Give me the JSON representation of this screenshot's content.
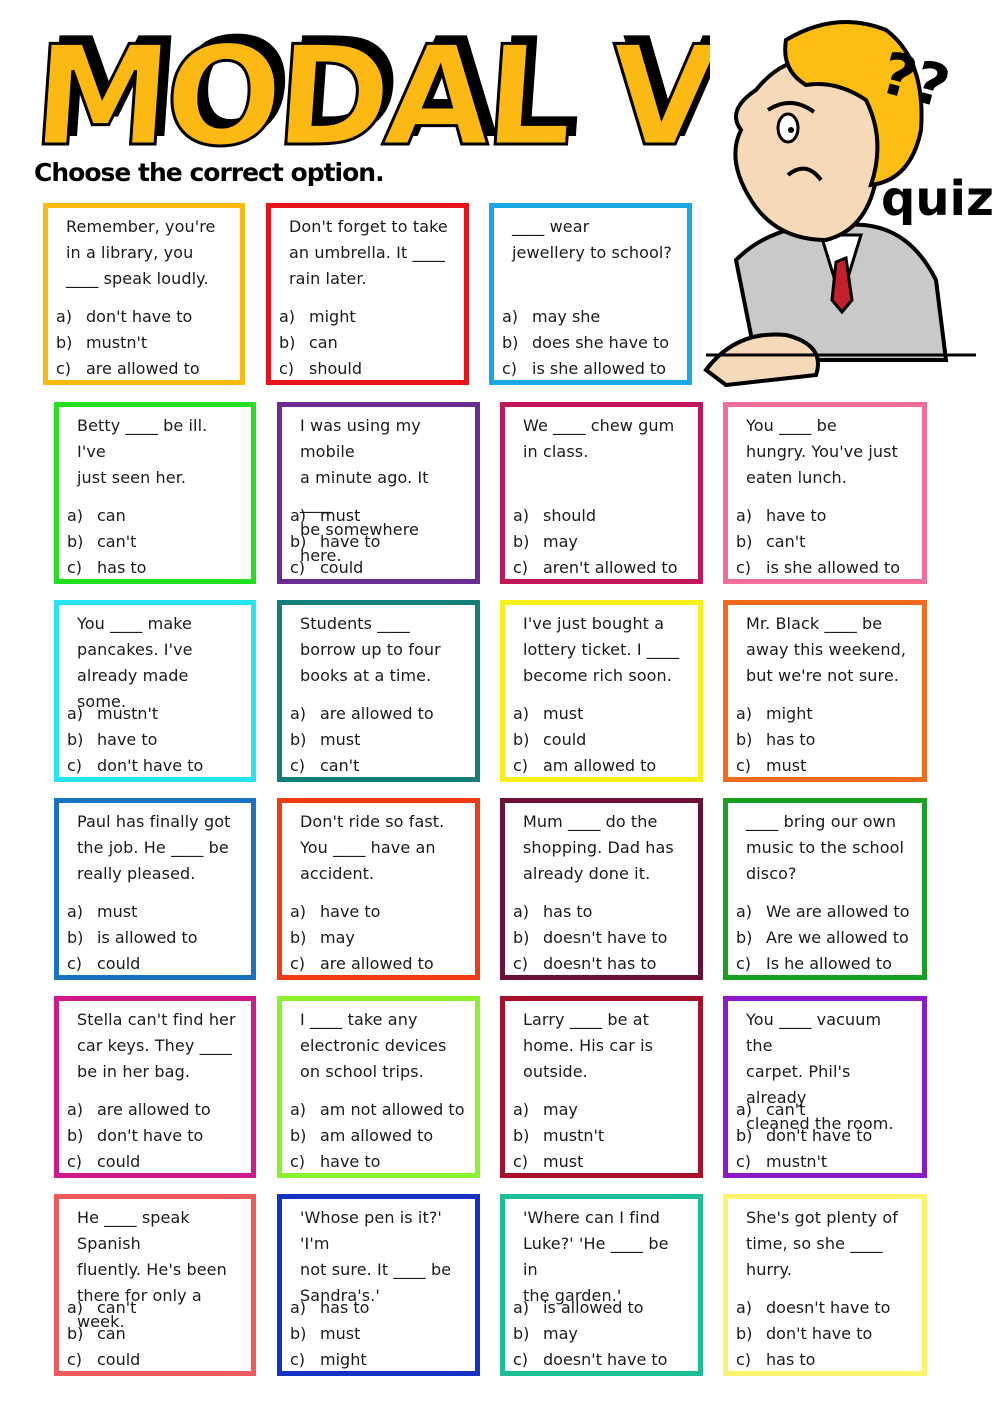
{
  "header": {
    "title": "MODAL VERBS",
    "instructions": "Choose the correct option.",
    "mascot_caption": "quiz",
    "mascot_marks": "??",
    "title_color": "#FDB913"
  },
  "option_letters": [
    "a)",
    "b)",
    "c)"
  ],
  "questions": [
    {
      "text": "Remember, you're\nin a library, you\n____ speak loudly.",
      "border": "#F9B90F",
      "options": [
        "don't have to",
        "mustn't",
        "are allowed to"
      ]
    },
    {
      "text": "Don't forget to take\nan umbrella. It ____\nrain later.",
      "border": "#E8141B",
      "options": [
        "might",
        "can",
        "should"
      ]
    },
    {
      "text": "____ wear\njewellery to school?",
      "border": "#1BA7E3",
      "options": [
        "may she",
        "does she have to",
        "is she allowed to"
      ]
    },
    {
      "text": "Betty ____ be ill. I've\njust seen her.",
      "border": "#22E01E",
      "options": [
        "can",
        "can't",
        "has to"
      ]
    },
    {
      "text": "I was using my mobile\na minute ago. It ____\nbe somewhere here.",
      "border": "#6A2C91",
      "options": [
        "must",
        "have to",
        "could"
      ]
    },
    {
      "text": "We ____ chew gum\nin class.",
      "border": "#C2185B",
      "options": [
        "should",
        "may",
        "aren't allowed to"
      ]
    },
    {
      "text": "You ____ be\nhungry. You've just\neaten lunch.",
      "border": "#F06C9B",
      "options": [
        "have to",
        "can't",
        "is she allowed to"
      ]
    },
    {
      "text": "You ____ make\npancakes. I've\nalready made some.",
      "border": "#24E5F0",
      "options": [
        "mustn't",
        "have to",
        "don't have to"
      ]
    },
    {
      "text": "Students ____\nborrow up to four\nbooks at a time.",
      "border": "#137D7A",
      "options": [
        "are allowed to",
        "must",
        "can't"
      ]
    },
    {
      "text": "I've just bought a\nlottery ticket. I ____\nbecome rich soon.",
      "border": "#F6F01A",
      "options": [
        "must",
        "could",
        "am allowed to"
      ]
    },
    {
      "text": "Mr. Black ____ be\naway this weekend,\nbut we're not sure.",
      "border": "#F26A1B",
      "options": [
        "might",
        "has to",
        "must"
      ]
    },
    {
      "text": "Paul has finally got\nthe job. He ____ be\nreally pleased.",
      "border": "#1A73C2",
      "options": [
        "must",
        "is allowed to",
        "could"
      ]
    },
    {
      "text": "Don't ride so fast.\nYou ____ have an\naccident.",
      "border": "#F23B12",
      "options": [
        "have to",
        "may",
        "are allowed to"
      ]
    },
    {
      "text": "Mum ____ do the\nshopping. Dad has\nalready done it.",
      "border": "#6B0F36",
      "options": [
        "has to",
        "doesn't have to",
        "doesn't has to"
      ]
    },
    {
      "text": "____ bring our own\nmusic to the school\ndisco?",
      "border": "#18A023",
      "options": [
        "We are allowed to",
        "Are we allowed to",
        "Is he allowed to"
      ]
    },
    {
      "text": "Stella can't find her\ncar keys. They ____\nbe in her bag.",
      "border": "#D0198B",
      "options": [
        "are allowed to",
        "don't have to",
        "could"
      ]
    },
    {
      "text": "I ____ take any\nelectronic devices\non school trips.",
      "border": "#8BF22B",
      "options": [
        "am not allowed to",
        "am allowed to",
        "have to"
      ]
    },
    {
      "text": "Larry ____ be at\nhome. His car is\noutside.",
      "border": "#A8102A",
      "options": [
        "may",
        "mustn't",
        "must"
      ]
    },
    {
      "text": "You ____ vacuum the\ncarpet. Phil's already\ncleaned the room.",
      "border": "#8E18C6",
      "options": [
        "can't",
        "don't have to",
        "mustn't"
      ]
    },
    {
      "text": "He ____ speak Spanish\nfluently. He's been\nthere for only a week.",
      "border": "#F05A5A",
      "options": [
        "can't",
        "can",
        "could"
      ]
    },
    {
      "text": "'Whose pen is it?' 'I'm\nnot sure. It ____ be\nSandra's.'",
      "border": "#1532C4",
      "options": [
        "has to",
        "must",
        "might"
      ]
    },
    {
      "text": "'Where can I find\nLuke?' 'He ____ be in\nthe garden.'",
      "border": "#1BBE95",
      "options": [
        "is allowed to",
        "may",
        "doesn't have to"
      ]
    },
    {
      "text": "She's got plenty of\ntime, so she ____\nhurry.",
      "border": "#FAF36B",
      "options": [
        "doesn't have to",
        "don't have to",
        "has to"
      ]
    }
  ]
}
